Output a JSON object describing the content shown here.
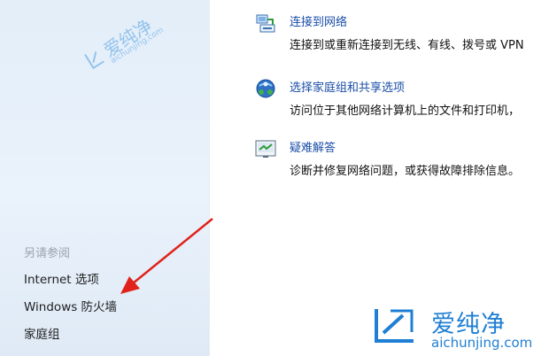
{
  "tasks": [
    {
      "title": "连接到网络",
      "description": "连接到或重新连接到无线、有线、拨号或 VPN",
      "icon": "network-connect-icon"
    },
    {
      "title": "选择家庭组和共享选项",
      "description": "访问位于其他网络计算机上的文件和打印机，",
      "icon": "homegroup-icon"
    },
    {
      "title": "疑难解答",
      "description": "诊断并修复网络问题，或获得故障排除信息。",
      "icon": "troubleshoot-icon"
    }
  ],
  "sidebar": {
    "see_also_title": "另请参阅",
    "links": [
      "Internet 选项",
      "Windows 防火墙",
      "家庭组"
    ]
  },
  "watermark": {
    "brand": "爱纯净",
    "url": "aichunjing.com",
    "small_brand": "爱纯净",
    "small_url": "aichunjing.com"
  },
  "annotation": {
    "arrow_color": "#e0221b",
    "points_to": "Windows 防火墙"
  },
  "colors": {
    "link": "#1a4da8",
    "sidebar_bg": "#e3eef9",
    "watermark": "#1f7fd4"
  }
}
